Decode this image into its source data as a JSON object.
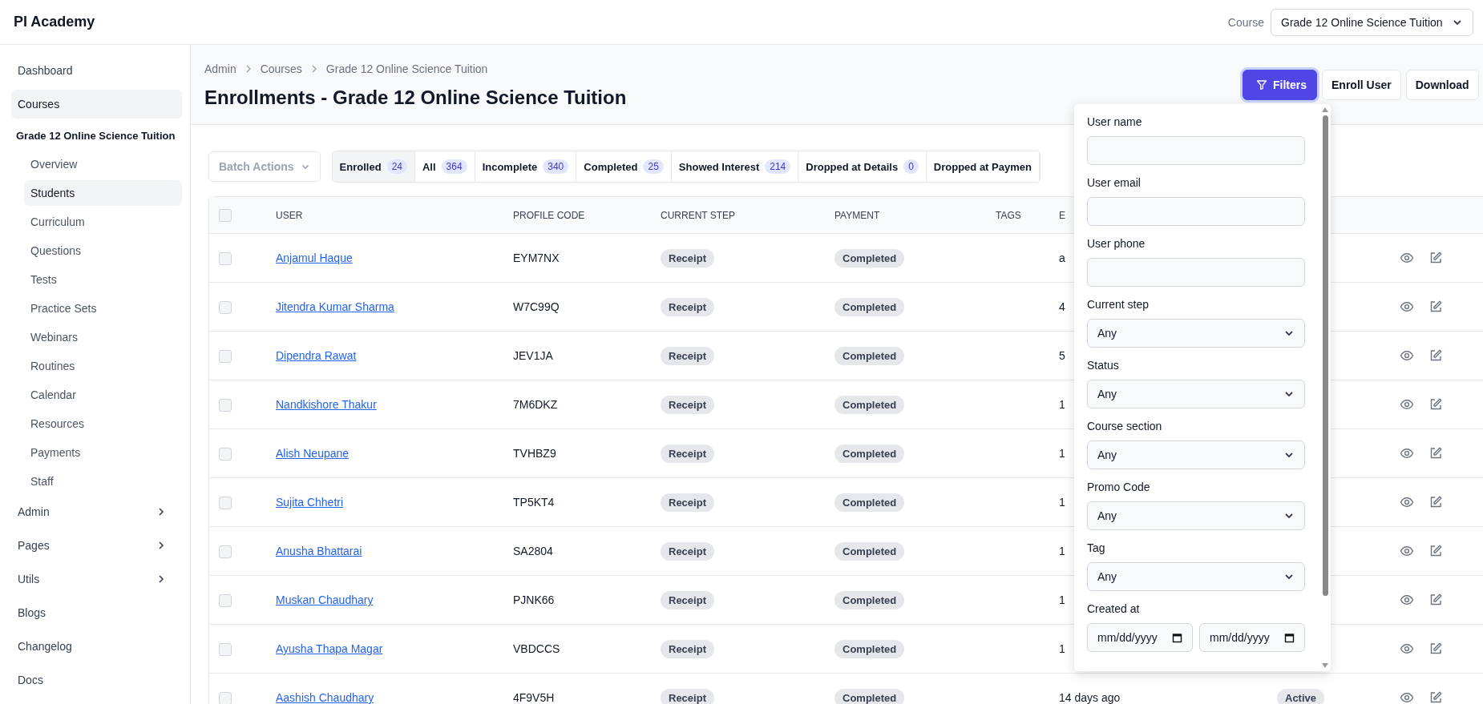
{
  "app": {
    "title": "PI Academy"
  },
  "course_picker": {
    "label": "Course",
    "value": "Grade 12 Online Science Tuition"
  },
  "sidebar": {
    "items": [
      {
        "label": "Dashboard",
        "kind": "link",
        "selected": false
      },
      {
        "label": "Courses",
        "kind": "link",
        "selected": true
      },
      {
        "label": "Grade 12 Online Science Tuition",
        "kind": "group",
        "children": [
          {
            "label": "Overview",
            "selected": false
          },
          {
            "label": "Students",
            "selected": true
          },
          {
            "label": "Curriculum",
            "selected": false
          },
          {
            "label": "Questions",
            "selected": false
          },
          {
            "label": "Tests",
            "selected": false
          },
          {
            "label": "Practice Sets",
            "selected": false
          },
          {
            "label": "Webinars",
            "selected": false
          },
          {
            "label": "Routines",
            "selected": false
          },
          {
            "label": "Calendar",
            "selected": false
          },
          {
            "label": "Resources",
            "selected": false
          },
          {
            "label": "Payments",
            "selected": false
          },
          {
            "label": "Staff",
            "selected": false
          }
        ]
      },
      {
        "label": "Admin",
        "kind": "expandable",
        "selected": false
      },
      {
        "label": "Pages",
        "kind": "expandable",
        "selected": false
      },
      {
        "label": "Utils",
        "kind": "expandable",
        "selected": false
      },
      {
        "label": "Blogs",
        "kind": "link",
        "selected": false
      },
      {
        "label": "Changelog",
        "kind": "link",
        "selected": false
      },
      {
        "label": "Docs",
        "kind": "link",
        "selected": false
      }
    ]
  },
  "breadcrumb": [
    "Admin",
    "Courses",
    "Grade 12 Online Science Tuition"
  ],
  "page_title": "Enrollments - Grade 12 Online Science Tuition",
  "actions": [
    {
      "label": "Filters",
      "kind": "primary",
      "selected": true
    },
    {
      "label": "Enroll User",
      "kind": "plain",
      "selected": false
    },
    {
      "label": "Download",
      "kind": "plain",
      "selected": false
    }
  ],
  "batch_actions": {
    "label": "Batch Actions",
    "disabled": true
  },
  "tabs": [
    {
      "label": "Enrolled",
      "count": "24",
      "selected": true
    },
    {
      "label": "All",
      "count": "364",
      "selected": false
    },
    {
      "label": "Incomplete",
      "count": "340",
      "selected": false
    },
    {
      "label": "Completed",
      "count": "25",
      "selected": false
    },
    {
      "label": "Showed Interest",
      "count": "214",
      "selected": false
    },
    {
      "label": "Dropped at Details",
      "count": "0",
      "selected": false
    },
    {
      "label": "Dropped at Paymen",
      "selected": false
    }
  ],
  "table": {
    "columns": [
      "USER",
      "PROFILE CODE",
      "CURRENT STEP",
      "PAYMENT",
      "TAGS",
      "E"
    ],
    "all_checked": false,
    "rows": [
      {
        "checked": false,
        "user": "Anjamul Haque",
        "profile_code": "EYM7NX",
        "current_step": "Receipt",
        "payment": "Completed",
        "column_6": "a"
      },
      {
        "checked": false,
        "user": "Jitendra Kumar Sharma",
        "profile_code": "W7C99Q",
        "current_step": "Receipt",
        "payment": "Completed",
        "column_6": "4"
      },
      {
        "checked": false,
        "user": "Dipendra Rawat",
        "profile_code": "JEV1JA",
        "current_step": "Receipt",
        "payment": "Completed",
        "column_6": "5"
      },
      {
        "checked": false,
        "user": "Nandkishore Thakur",
        "profile_code": "7M6DKZ",
        "current_step": "Receipt",
        "payment": "Completed",
        "column_6": "1"
      },
      {
        "checked": false,
        "user": "Alish Neupane",
        "profile_code": "TVHBZ9",
        "current_step": "Receipt",
        "payment": "Completed",
        "column_6": "1"
      },
      {
        "checked": false,
        "user": "Sujita Chhetri",
        "profile_code": "TP5KT4",
        "current_step": "Receipt",
        "payment": "Completed",
        "column_6": "1"
      },
      {
        "checked": false,
        "user": "Anusha Bhattarai",
        "profile_code": "SA2804",
        "current_step": "Receipt",
        "payment": "Completed",
        "column_6": "1"
      },
      {
        "checked": false,
        "user": "Muskan Chaudhary",
        "profile_code": "PJNK66",
        "current_step": "Receipt",
        "payment": "Completed",
        "column_6": "1"
      },
      {
        "checked": false,
        "user": "Ayusha Thapa Magar",
        "profile_code": "VBDCCS",
        "current_step": "Receipt",
        "payment": "Completed",
        "column_6": "1"
      },
      {
        "checked": false,
        "user": "Aashish Chaudhary",
        "profile_code": "4F9V5H",
        "current_step": "Receipt",
        "payment": "Completed",
        "column_6": "14 days ago",
        "status": "Active"
      }
    ]
  },
  "filters_panel": {
    "fields": [
      {
        "label": "User name",
        "kind": "text"
      },
      {
        "label": "User email",
        "kind": "text"
      },
      {
        "label": "User phone",
        "kind": "text"
      },
      {
        "label": "Current step",
        "kind": "select",
        "value": "Any"
      },
      {
        "label": "Status",
        "kind": "select",
        "value": "Any"
      },
      {
        "label": "Course section",
        "kind": "select",
        "value": "Any"
      },
      {
        "label": "Promo Code",
        "kind": "select",
        "value": "Any"
      },
      {
        "label": "Tag",
        "kind": "select",
        "value": "Any"
      },
      {
        "label": "Created at",
        "kind": "daterange",
        "from": "mm/dd/yyyy",
        "to": "mm/dd/yyyy"
      }
    ]
  }
}
